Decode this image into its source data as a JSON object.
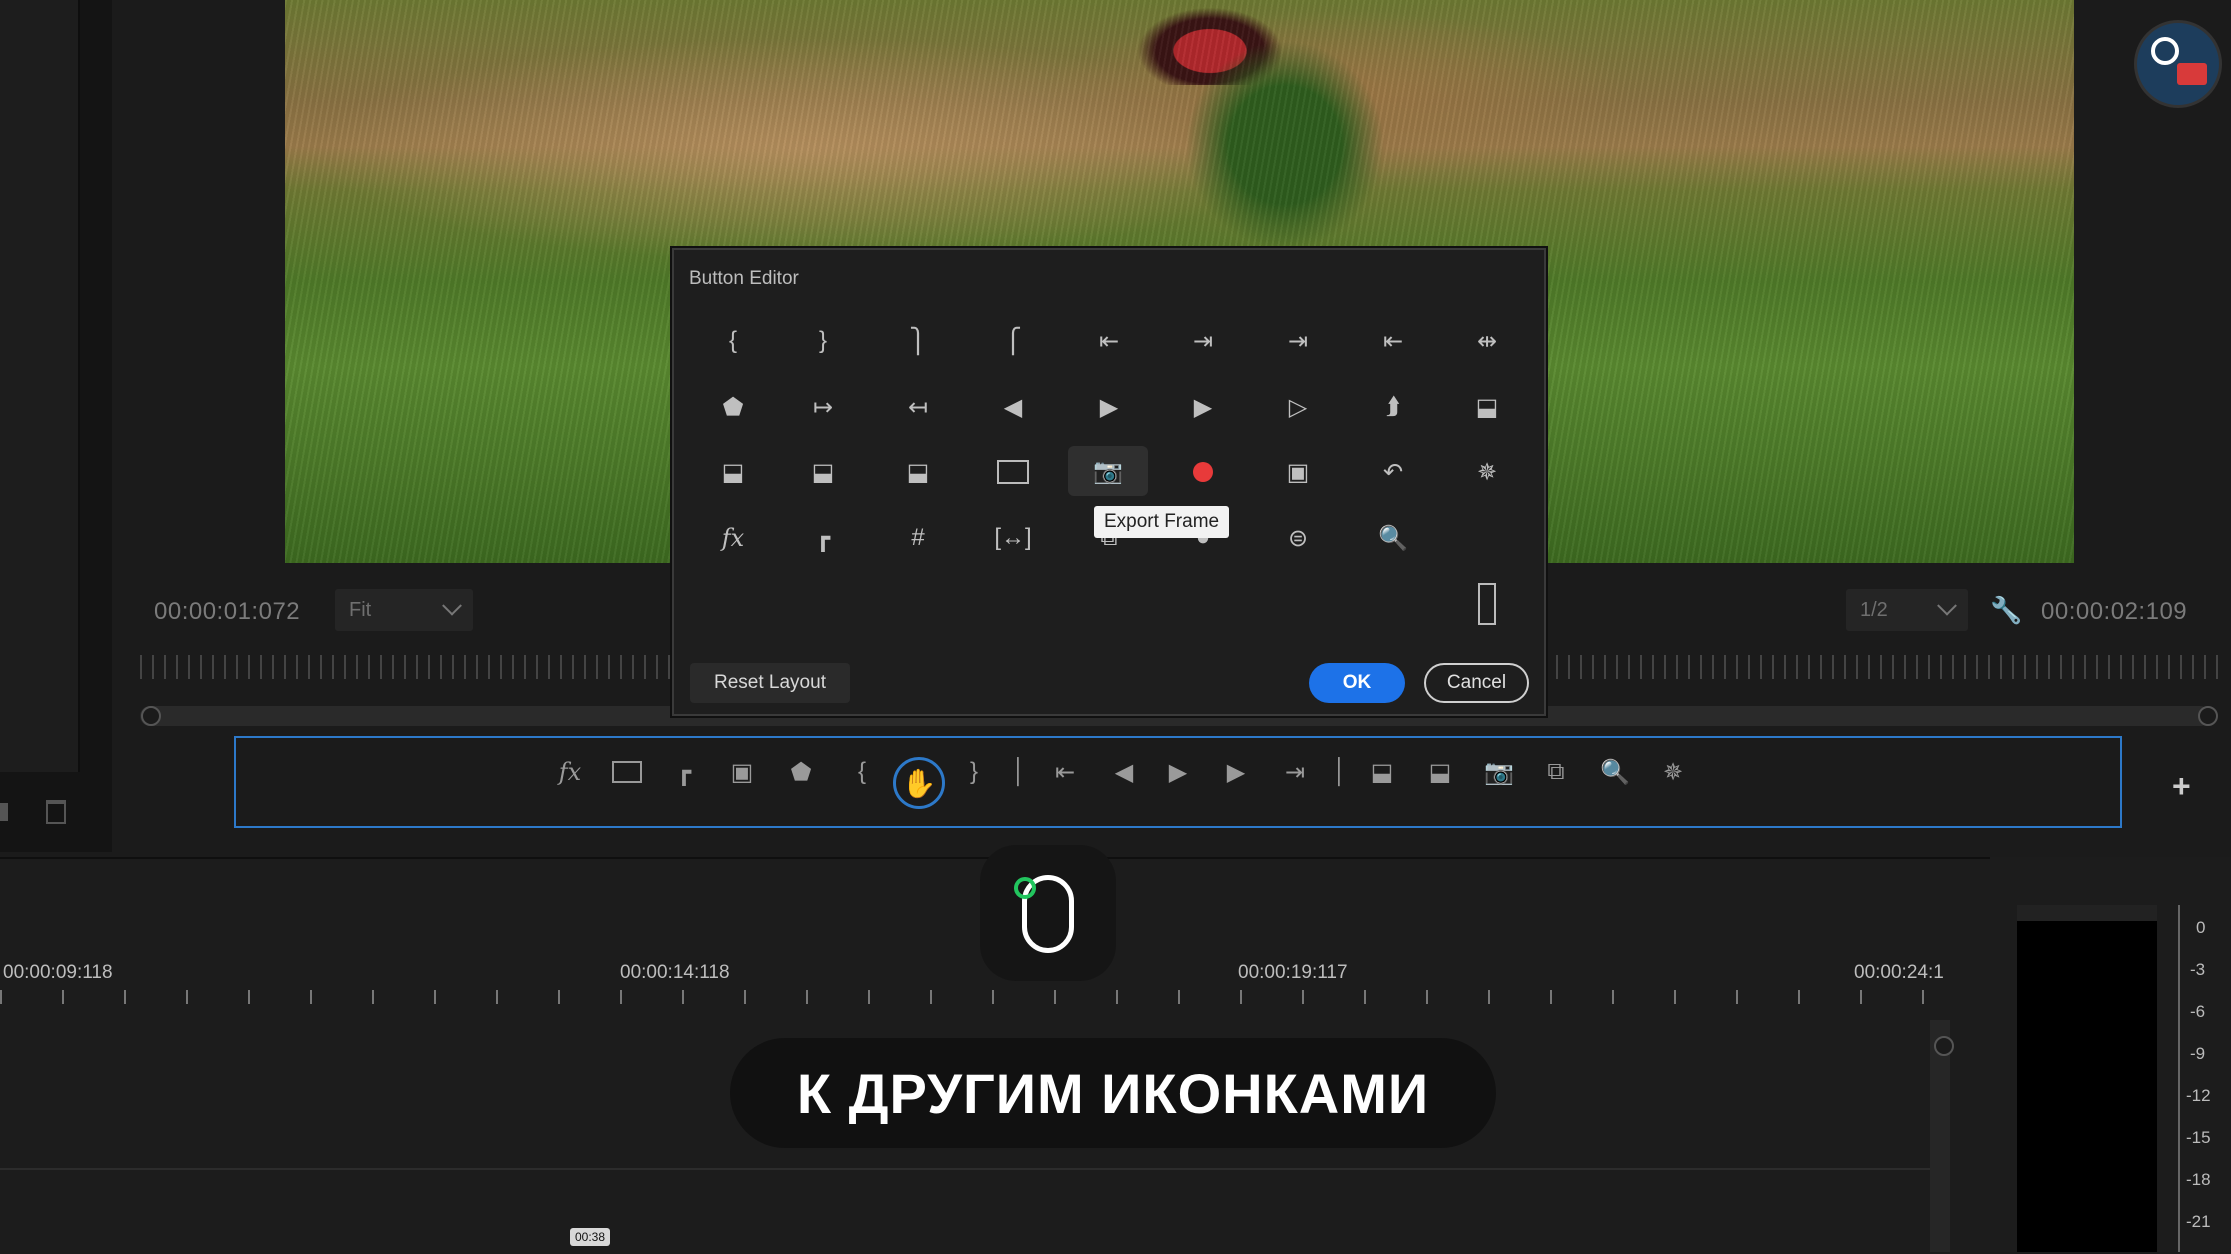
{
  "monitor": {
    "timecode_left": "00:00:01:072",
    "zoom_select": "Fit",
    "quality_select": "1/2",
    "timecode_right": "00:00:02:109"
  },
  "dialog": {
    "title": "Button Editor",
    "tooltip": "Export Frame",
    "reset_label": "Reset Layout",
    "ok_label": "OK",
    "cancel_label": "Cancel"
  },
  "timeline": {
    "times": [
      "00:00:09:118",
      "00:00:14:118",
      "00:00:19:117",
      "00:00:24:1"
    ],
    "small_tag": "00:38"
  },
  "meter": {
    "labels": [
      "0",
      "-3",
      "-6",
      "-9",
      "-12",
      "-15",
      "-18",
      "-21"
    ]
  },
  "caption": "К ДРУГИМ ИКОНКАМИ",
  "colors": {
    "accent_blue": "#1d72e8",
    "record_red": "#e83a3a",
    "selection_border": "#2d79c9"
  }
}
